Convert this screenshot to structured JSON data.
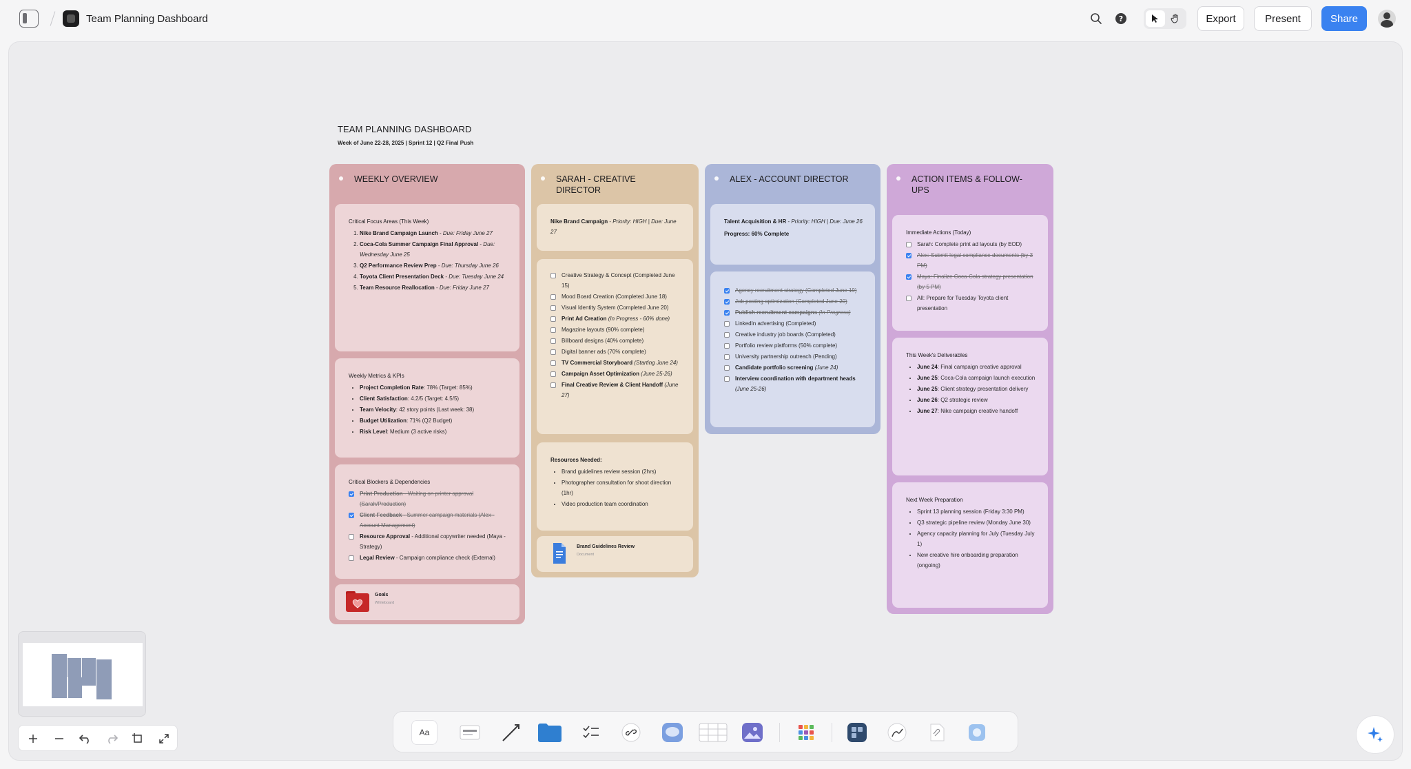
{
  "app": {
    "title": "Team Planning Dashboard",
    "buttons": {
      "export": "Export",
      "present": "Present",
      "share": "Share"
    }
  },
  "board": {
    "title": "TEAM PLANNING DASHBOARD",
    "subtitle": "Week of June 22-28, 2025 | Sprint 12 | Q2 Final Push"
  },
  "columns": {
    "weekly": {
      "title": "WEEKLY OVERVIEW",
      "color": "#d5a9ac",
      "focus": {
        "heading": "Critical Focus Areas (This Week)",
        "items": [
          {
            "b": "Nike Brand Campaign Launch",
            "rest": " - ",
            "i": "Due: Friday June 27"
          },
          {
            "b": "Coca-Cola Summer Campaign Final Approval",
            "rest": " - ",
            "i": "Due: Wednesday June 25"
          },
          {
            "b": "Q2 Performance Review Prep",
            "rest": " - ",
            "i": "Due: Thursday June 26"
          },
          {
            "b": "Toyota Client Presentation Deck",
            "rest": " - ",
            "i": "Due: Tuesday June 24"
          },
          {
            "b": "Team Resource Reallocation",
            "rest": " - ",
            "i": "Due: Friday June 27"
          }
        ]
      },
      "metrics": {
        "heading": "Weekly Metrics & KPIs",
        "items": [
          {
            "b": "Project Completion Rate",
            "rest": ": 78% (Target: 85%)"
          },
          {
            "b": "Client Satisfaction",
            "rest": ": 4.2/5 (Target: 4.5/5)"
          },
          {
            "b": "Team Velocity",
            "rest": ": 42 story points (Last week: 38)"
          },
          {
            "b": "Budget Utilization",
            "rest": ": 71% (Q2 Budget)"
          },
          {
            "b": "Risk Level",
            "rest": ": Medium (3 active risks)"
          }
        ]
      },
      "blockers": {
        "heading": "Critical Blockers & Dependencies",
        "items": [
          {
            "b": "Print Production",
            "rest": " - Waiting on printer approval (Sarah/Production)",
            "done": true
          },
          {
            "b": "Client Feedback",
            "rest": " - Summer campaign materials (Alex - Account Management)",
            "done": true
          },
          {
            "b": "Resource Approval",
            "rest": " - Additional copywriter needed (Maya - Strategy)",
            "done": false
          },
          {
            "b": "Legal Review",
            "rest": " - Campaign compliance check (External)",
            "done": false
          }
        ]
      },
      "file": {
        "name": "Goals",
        "type": "Whiteboard"
      }
    },
    "sarah": {
      "title": "SARAH - CREATIVE DIRECTOR",
      "color": "#d8c2a5",
      "priority": {
        "b": "Nike Brand Campaign",
        "i": "Priority: HIGH | Due: June 27"
      },
      "tasks": [
        {
          "t": "Creative Strategy & Concept (Completed June 15)"
        },
        {
          "t": "Mood Board Creation (Completed June 18)"
        },
        {
          "t": "Visual Identity System (Completed June 20)"
        },
        {
          "b": "Print Ad Creation",
          "i": "(In Progress - 60% done)"
        },
        {
          "t": "Magazine layouts (90% complete)"
        },
        {
          "t": "Billboard designs (40% complete)"
        },
        {
          "t": "Digital banner ads (70% complete)"
        },
        {
          "b": "TV Commercial Storyboard",
          "i": "(Starting June 24)"
        },
        {
          "b": "Campaign Asset Optimization",
          "i": "(June 25-26)"
        },
        {
          "b": "Final Creative Review & Client Handoff",
          "i": "(June 27)"
        }
      ],
      "resources": {
        "heading": "Resources Needed:",
        "items": [
          "Brand guidelines review session (2hrs)",
          "Photographer consultation for shoot direction (1hr)",
          "Video production team coordination"
        ]
      },
      "file": {
        "name": "Brand Guidelines Review",
        "type": "Document"
      }
    },
    "alex": {
      "title": "ALEX - ACCOUNT DIRECTOR",
      "color": "#aab5d6",
      "priority": {
        "b": "Talent Acquisition & HR",
        "i": "Priority: HIGH | Due: June 26",
        "progress": "Progress: 60% Complete"
      },
      "tasks": [
        {
          "t": "Agency recruitment strategy (Completed June 19)",
          "done": true
        },
        {
          "t": "Job posting optimization (Completed June 20)",
          "done": true
        },
        {
          "b": "Publish recruitment campaigns",
          "i": "(In Progress)",
          "done": true
        },
        {
          "t": "LinkedIn advertising (Completed)"
        },
        {
          "t": "Creative industry job boards (Completed)"
        },
        {
          "t": "Portfolio review platforms (50% complete)"
        },
        {
          "t": "University partnership outreach (Pending)"
        },
        {
          "b": "Candidate portfolio screening",
          "i": "(June 24)"
        },
        {
          "b": "Interview coordination with department heads",
          "i": "(June 25-26)"
        }
      ]
    },
    "actions": {
      "title": "ACTION ITEMS & FOLLOW-UPS",
      "color": "#cda6d6",
      "immediate": {
        "heading": "Immediate Actions (Today)",
        "items": [
          {
            "t": "Sarah: Complete print ad layouts (by EOD)",
            "done": false
          },
          {
            "t": "Alex: Submit legal compliance documents (by 3 PM)",
            "done": true
          },
          {
            "t": "Maya: Finalize Coca-Cola strategy presentation (by 5 PM)",
            "done": true
          },
          {
            "t": "All: Prepare for Tuesday Toyota client presentation",
            "done": false
          }
        ]
      },
      "deliverables": {
        "heading": "This Week's Deliverables",
        "items": [
          {
            "b": "June 24",
            "rest": ": Final campaign creative approval"
          },
          {
            "b": "June 25",
            "rest": ": Coca-Cola campaign launch execution"
          },
          {
            "b": "June 25",
            "rest": ": Client strategy presentation delivery"
          },
          {
            "b": "June 26",
            "rest": ": Q2 strategic review"
          },
          {
            "b": "June 27",
            "rest": ": Nike campaign creative handoff"
          }
        ]
      },
      "next": {
        "heading": "Next Week Preparation",
        "items": [
          "Sprint 13 planning session (Friday 3:30 PM)",
          "Q3 strategic pipeline review (Monday June 30)",
          "Agency capacity planning for July (Tuesday July 1)",
          "New creative hire onboarding preparation (ongoing)"
        ]
      }
    }
  },
  "dock": {
    "text_tool": "Aa"
  }
}
